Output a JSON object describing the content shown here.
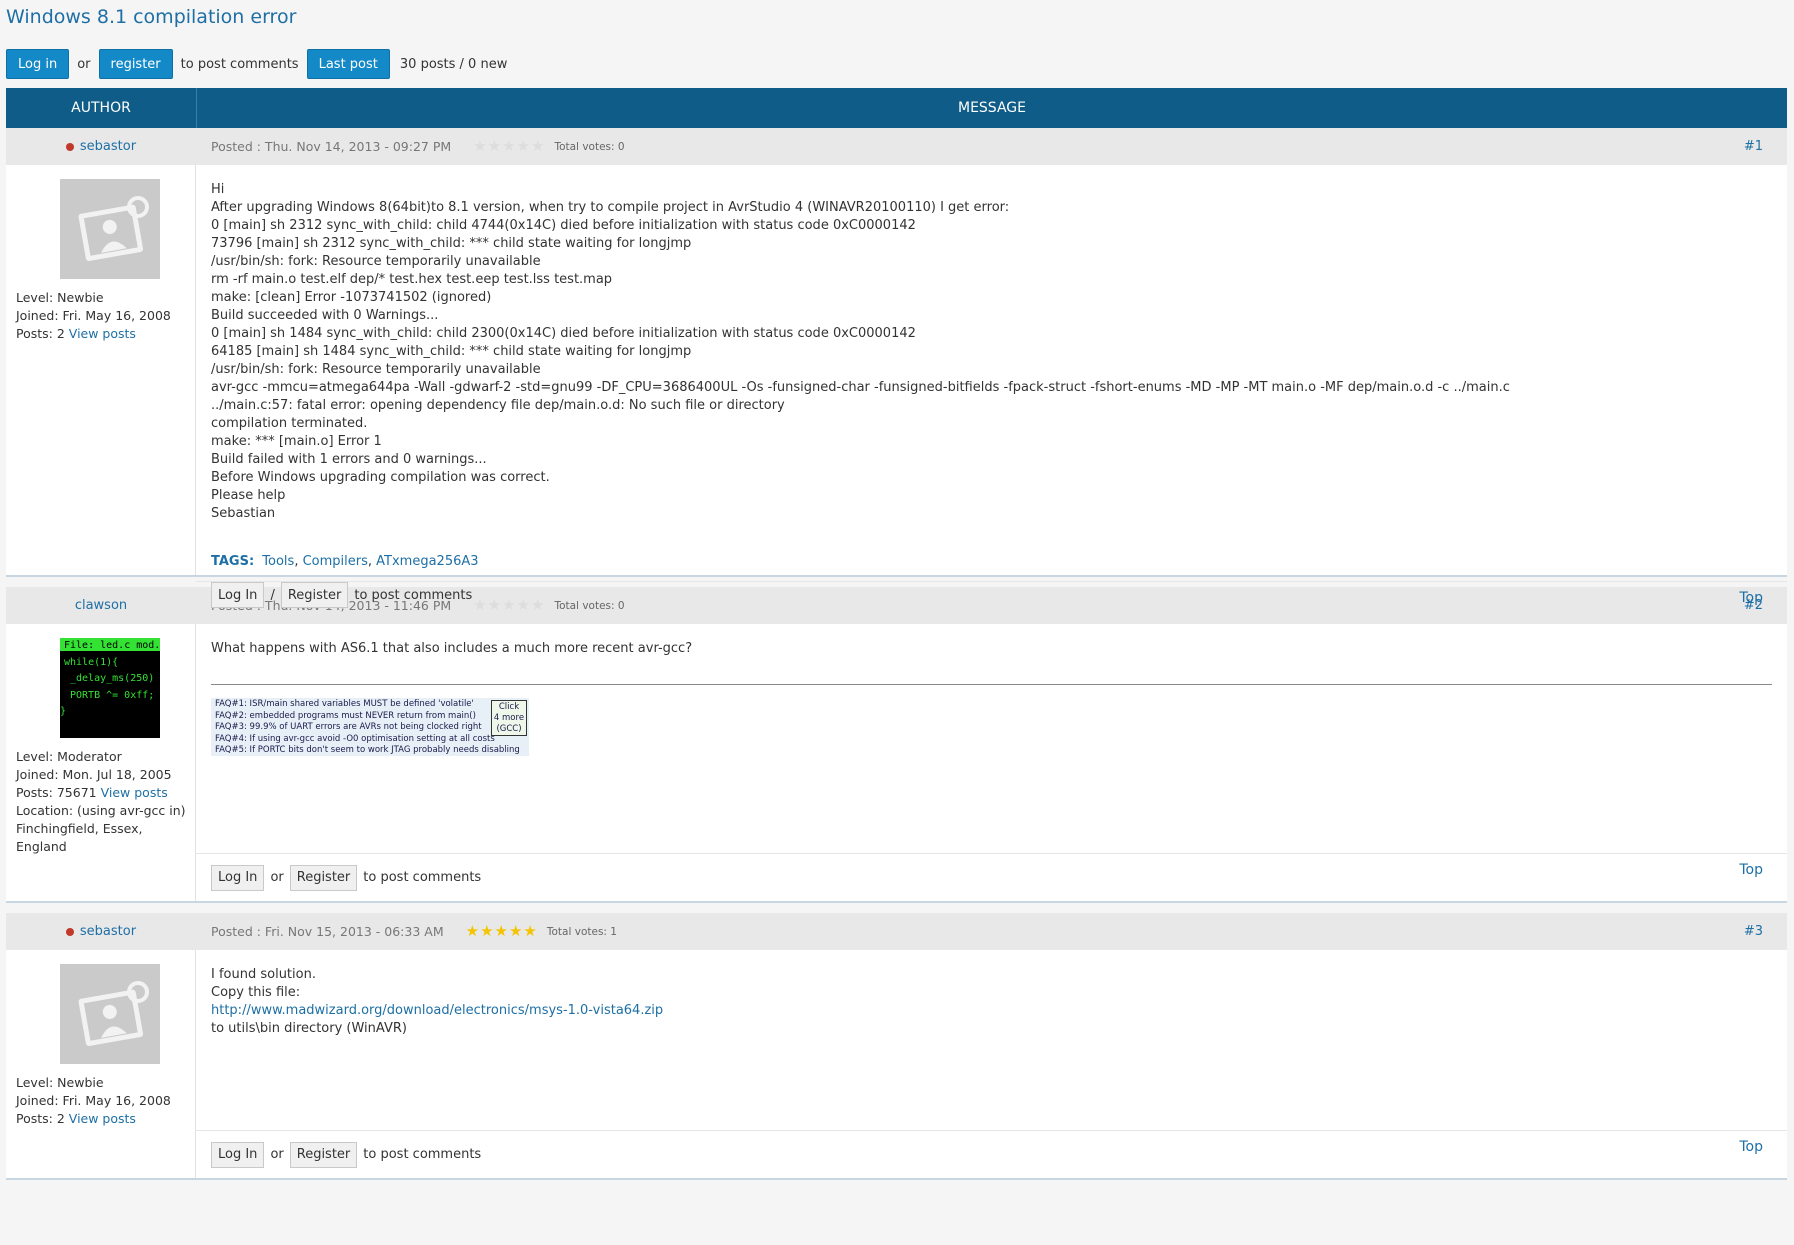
{
  "page": {
    "title": "Windows 8.1 compilation error",
    "login_label": "Log in",
    "or_text": "or",
    "register_label": "register",
    "to_post_comments": "to post comments",
    "last_post_label": "Last post",
    "post_count": "30 posts / 0 new"
  },
  "table": {
    "author_header": "AUTHOR",
    "message_header": "MESSAGE"
  },
  "colors": {
    "header_bg": "#0e5c87",
    "button_blue": "#1489c8",
    "link": "#1d6fa5",
    "star": "#f5c400",
    "online": "#c0392b"
  },
  "posts": [
    {
      "author": "sebastor",
      "online": true,
      "avatar": "default-avatar-icon",
      "level": "Level: Newbie",
      "joined": "Joined: Fri. May 16, 2008",
      "posts_label": "Posts: 2",
      "view_posts": "View posts",
      "posted": "Posted : Thu. Nov 14, 2013 - 09:27 PM",
      "rating": 0,
      "votes": "Total votes: 0",
      "num": "#1",
      "lines": [
        "Hi",
        "After upgrading Windows 8(64bit)to 8.1 version, when try to compile project in AvrStudio 4 (WINAVR20100110) I get error:",
        "0 [main] sh 2312 sync_with_child: child 4744(0x14C) died before initialization with status code 0xC0000142",
        "73796 [main] sh 2312 sync_with_child: *** child state waiting for longjmp",
        "/usr/bin/sh: fork: Resource temporarily unavailable",
        "rm -rf main.o test.elf dep/* test.hex test.eep test.lss test.map",
        "make: [clean] Error -1073741502 (ignored)",
        "Build succeeded with 0 Warnings...",
        "0 [main] sh 1484 sync_with_child: child 2300(0x14C) died before initialization with status code 0xC0000142",
        "64185 [main] sh 1484 sync_with_child: *** child state waiting for longjmp",
        "/usr/bin/sh: fork: Resource temporarily unavailable",
        "avr-gcc -mmcu=atmega644pa -Wall -gdwarf-2 -std=gnu99 -DF_CPU=3686400UL -Os -funsigned-char -funsigned-bitfields -fpack-struct -fshort-enums -MD -MP -MT main.o -MF dep/main.o.d -c ../main.c",
        "../main.c:57: fatal error: opening dependency file dep/main.o.d: No such file or directory",
        "compilation terminated.",
        "make: *** [main.o] Error 1",
        "Build failed with 1 errors and 0 warnings...",
        "Before Windows upgrading compilation was correct.",
        "Please help",
        "Sebastian"
      ],
      "tags_label": "TAGS:",
      "tags": [
        "Tools",
        "Compilers",
        "ATxmega256A3"
      ],
      "foot_login": "Log In",
      "foot_sep": "/",
      "foot_register": "Register",
      "foot_text": "to post comments",
      "top": "Top"
    },
    {
      "author": "clawson",
      "online": false,
      "avatar": "code-avatar",
      "avatar_code": [
        "File: led.c   mod.",
        "while(1){",
        "_delay_ms(250)",
        "PORTB ^= 0xff;",
        "}"
      ],
      "level": "Level: Moderator",
      "joined": "Joined: Mon. Jul 18, 2005",
      "posts_label": "Posts: 75671",
      "view_posts": "View posts",
      "location": [
        "Location: (using avr-gcc in)",
        "Finchingfield, Essex,",
        "England"
      ],
      "posted": "Posted : Thu. Nov 14, 2013 - 11:46 PM",
      "rating": 0,
      "votes": "Total votes: 0",
      "num": "#2",
      "lines": [
        "What happens with AS6.1 that also includes a much more recent avr-gcc?"
      ],
      "faq": [
        "FAQ#1: ISR/main shared variables MUST be defined 'volatile'",
        "FAQ#2: embedded programs must NEVER return from main()",
        "FAQ#3: 99.9% of UART errors are AVRs not being clocked right",
        "FAQ#4: If using avr-gcc avoid -O0 optimisation setting at all costs",
        "FAQ#5: If PORTC bits don't seem to work JTAG probably needs disabling"
      ],
      "faq_click": [
        "Click",
        "4 more",
        "(GCC)"
      ],
      "foot_login": "Log In",
      "foot_sep": "or",
      "foot_register": "Register",
      "foot_text": "to post comments",
      "top": "Top"
    },
    {
      "author": "sebastor",
      "online": true,
      "avatar": "default-avatar-icon",
      "level": "Level: Newbie",
      "joined": "Joined: Fri. May 16, 2008",
      "posts_label": "Posts: 2",
      "view_posts": "View posts",
      "posted": "Posted : Fri. Nov 15, 2013 - 06:33 AM",
      "rating": 5,
      "votes": "Total votes: 1",
      "num": "#3",
      "lines": [
        "I found solution.",
        "Copy this file:"
      ],
      "link": "http://www.madwizard.org/download/electronics/msys-1.0-vista64.zip",
      "after_link": "to utils\\bin directory (WinAVR)",
      "foot_login": "Log In",
      "foot_sep": "or",
      "foot_register": "Register",
      "foot_text": "to post comments",
      "top": "Top"
    }
  ]
}
